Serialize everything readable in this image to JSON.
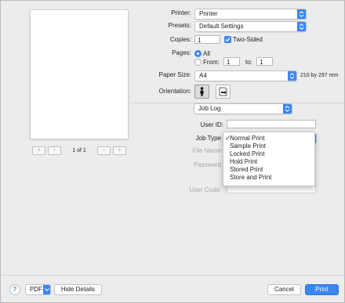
{
  "printer": {
    "label": "Printer:",
    "value": "Printer"
  },
  "presets": {
    "label": "Presets:",
    "value": "Default Settings"
  },
  "copies": {
    "label": "Copies:",
    "value": "1",
    "two_sided_label": "Two-Sided",
    "two_sided_checked": true
  },
  "pages": {
    "label": "Pages:",
    "all_label": "All",
    "from_label": "From:",
    "from_value": "1",
    "to_label": "to:",
    "to_value": "1",
    "selected": "All"
  },
  "paper_size": {
    "label": "Paper Size:",
    "value": "A4",
    "dimensions": "210 by 297 mm"
  },
  "orientation": {
    "label": "Orientation:",
    "selected": "portrait"
  },
  "section": {
    "value": "Job Log"
  },
  "user_id": {
    "label": "User ID:",
    "value": ""
  },
  "job_type": {
    "label": "Job Type",
    "selected": "Normal Print",
    "options": [
      "Normal Print",
      "Sample Print",
      "Locked Print",
      "Hold Print",
      "Stored Print",
      "Store and Print"
    ]
  },
  "file_name": {
    "label": "File Name"
  },
  "password": {
    "label": "Password"
  },
  "user_code": {
    "label": "User Code:"
  },
  "preview": {
    "page_indicator": "1 of 1"
  },
  "footer": {
    "help_glyph": "?",
    "pdf_label": "PDF",
    "hide_details_label": "Hide Details",
    "cancel_label": "Cancel",
    "print_label": "Print"
  },
  "accent_color": "#3b87f0"
}
